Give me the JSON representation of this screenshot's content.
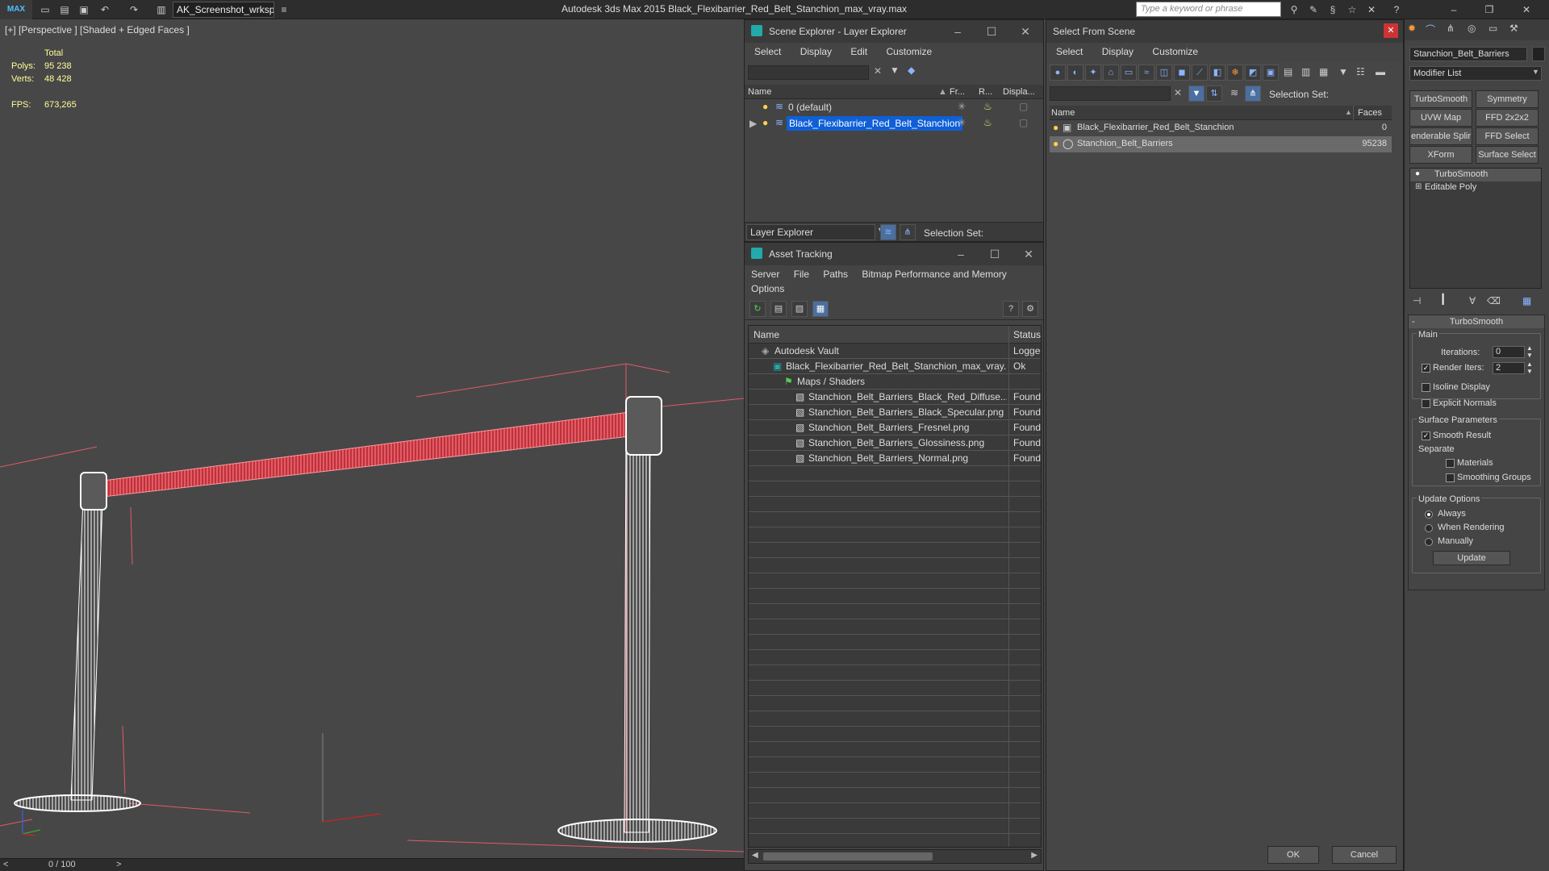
{
  "app": {
    "logo": "MAX",
    "workspace": "AK_Screenshot_wrksp",
    "title": "Autodesk 3ds Max  2015    Black_Flexibarrier_Red_Belt_Stanchion_max_vray.max",
    "search_placeholder": "Type a keyword or phrase"
  },
  "viewport": {
    "label": "[+] [Perspective ] [Shaded + Edged Faces ]",
    "stats": {
      "total_label": "Total",
      "polys_label": "Polys:",
      "polys": "95 238",
      "verts_label": "Verts:",
      "verts": "48 428",
      "fps_label": "FPS:",
      "fps": "673,265"
    },
    "timeline": "0 / 100",
    "prev": "<",
    "next": ">"
  },
  "scene_explorer": {
    "title": "Scene Explorer - Layer Explorer",
    "menu": [
      "Select",
      "Display",
      "Edit",
      "Customize"
    ],
    "columns": [
      "Name",
      "Fr...",
      "R...",
      "Displa..."
    ],
    "rows": [
      {
        "name": "0 (default)",
        "selected": false
      },
      {
        "name": "Black_Flexibarrier_Red_Belt_Stanchion",
        "selected": true
      }
    ],
    "footer_dropdown": "Layer Explorer",
    "selection_set_label": "Selection Set:"
  },
  "asset_tracking": {
    "title": "Asset Tracking",
    "menu": [
      "Server",
      "File",
      "Paths",
      "Bitmap Performance and Memory",
      "Options"
    ],
    "columns": [
      "Name",
      "Status"
    ],
    "rows": [
      {
        "name": "Autodesk Vault",
        "status": "Logged",
        "indent": 0
      },
      {
        "name": "Black_Flexibarrier_Red_Belt_Stanchion_max_vray...",
        "status": "Ok",
        "indent": 1
      },
      {
        "name": "Maps / Shaders",
        "status": "",
        "indent": 2
      },
      {
        "name": "Stanchion_Belt_Barriers_Black_Red_Diffuse...",
        "status": "Found",
        "indent": 3
      },
      {
        "name": "Stanchion_Belt_Barriers_Black_Specular.png",
        "status": "Found",
        "indent": 3
      },
      {
        "name": "Stanchion_Belt_Barriers_Fresnel.png",
        "status": "Found",
        "indent": 3
      },
      {
        "name": "Stanchion_Belt_Barriers_Glossiness.png",
        "status": "Found",
        "indent": 3
      },
      {
        "name": "Stanchion_Belt_Barriers_Normal.png",
        "status": "Found",
        "indent": 3
      }
    ]
  },
  "select_from_scene": {
    "title": "Select From Scene",
    "menu": [
      "Select",
      "Display",
      "Customize"
    ],
    "selection_set_label": "Selection Set:",
    "columns": [
      "Name",
      "Faces"
    ],
    "rows": [
      {
        "name": "Black_Flexibarrier_Red_Belt_Stanchion",
        "faces": "0"
      },
      {
        "name": "Stanchion_Belt_Barriers",
        "faces": "95238"
      }
    ],
    "ok": "OK",
    "cancel": "Cancel"
  },
  "command_panel": {
    "object_name": "Stanchion_Belt_Barriers",
    "modifier_list": "Modifier List",
    "buttons": [
      "TurboSmooth",
      "Symmetry",
      "UVW Map",
      "FFD 2x2x2",
      "enderable Splir",
      "FFD Select",
      "XForm",
      "Surface Select"
    ],
    "stack": [
      "TurboSmooth",
      "Editable Poly"
    ],
    "rollout_title": "TurboSmooth",
    "main_label": "Main",
    "iterations_label": "Iterations:",
    "iterations": "0",
    "render_iters_label": "Render Iters:",
    "render_iters": "2",
    "isoline_label": "Isoline Display",
    "explicit_normals_label": "Explicit Normals",
    "surface_params_label": "Surface Parameters",
    "smooth_result_label": "Smooth Result",
    "separate_label": "Separate",
    "materials_label": "Materials",
    "smoothing_groups_label": "Smoothing Groups",
    "update_options_label": "Update Options",
    "always_label": "Always",
    "when_rendering_label": "When Rendering",
    "manually_label": "Manually",
    "update_button": "Update"
  },
  "colors": {
    "accent": "#0f5fd6",
    "belt": "#e03a44",
    "wire": "#ffffff"
  }
}
